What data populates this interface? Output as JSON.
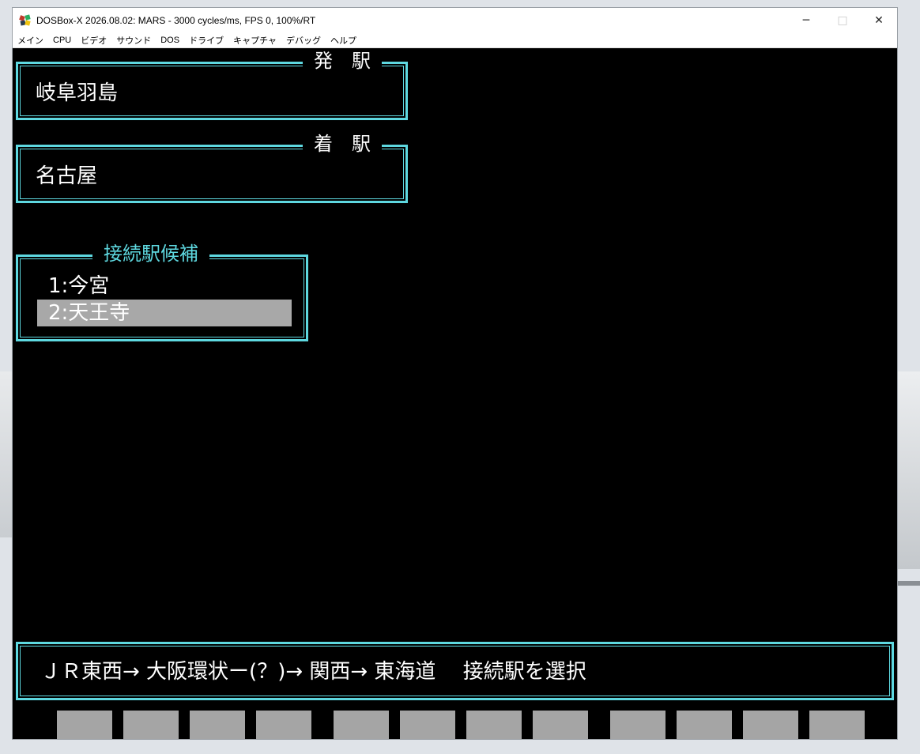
{
  "window": {
    "title": "DOSBox-X 2026.08.02: MARS - 3000 cycles/ms, FPS  0, 100%/RT",
    "controls": {
      "minimize": "─",
      "maximize": "□",
      "close": "✕"
    }
  },
  "menu": [
    "メイン",
    "CPU",
    "ビデオ",
    "サウンド",
    "DOS",
    "ドライブ",
    "キャプチャ",
    "デバッグ",
    "ヘルプ"
  ],
  "departure": {
    "label": "発　駅",
    "value": "岐阜羽島"
  },
  "arrival": {
    "label": "着　駅",
    "value": "名古屋"
  },
  "candidates": {
    "label": "接続駅候補",
    "items": [
      {
        "text": "1:今宮",
        "selected": false
      },
      {
        "text": "2:天王寺",
        "selected": true
      }
    ]
  },
  "status": {
    "text": "ＪＲ東西→ 大阪環状ー(？)→ 関西→ 東海道　 接続駅を選択"
  },
  "colors": {
    "frame": "#5ed8e0",
    "highlight": "#a8a8a8",
    "screen_bg": "#000000"
  }
}
